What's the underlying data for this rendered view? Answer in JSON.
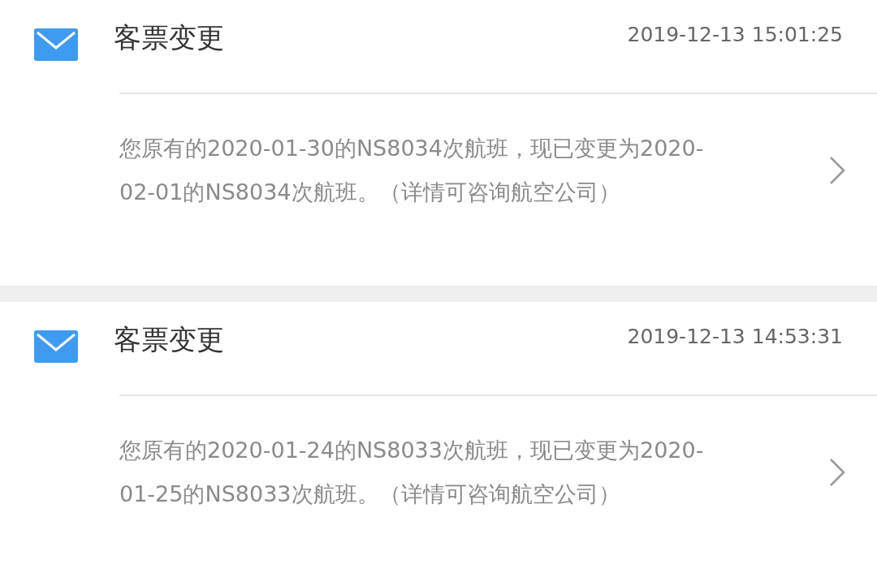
{
  "messages": [
    {
      "title": "客票变更",
      "time": "2019-12-13 15:01:25",
      "body": "您原有的2020-01-30的NS8034次航班，现已变更为2020-02-01的NS8034次航班。（详情可咨询航空公司）"
    },
    {
      "title": "客票变更",
      "time": "2019-12-13 14:53:31",
      "body": "您原有的2020-01-24的NS8033次航班，现已变更为2020-01-25的NS8033次航班。（详情可咨询航空公司）"
    }
  ]
}
